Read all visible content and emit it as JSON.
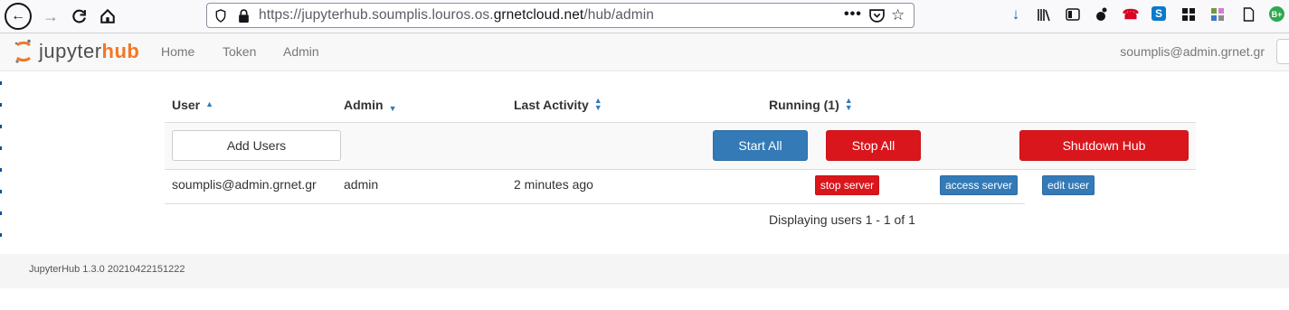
{
  "browser": {
    "url_prefix": "https://jupyterhub.soumplis.louros.os.",
    "url_host": "grnetcloud.net",
    "url_path": "/hub/admin",
    "extension_badge": "B+"
  },
  "header": {
    "logo_primary": "jupyter",
    "logo_secondary": "hub",
    "nav": [
      {
        "label": "Home"
      },
      {
        "label": "Token"
      },
      {
        "label": "Admin"
      }
    ],
    "user": "soumplis@admin.grnet.gr"
  },
  "table": {
    "columns": [
      {
        "label": "User",
        "sort": "asc"
      },
      {
        "label": "Admin",
        "sort": "desc"
      },
      {
        "label": "Last Activity",
        "sort": "both"
      },
      {
        "label": "Running (1)",
        "sort": "both"
      }
    ],
    "actions": {
      "add_users": "Add Users",
      "start_all": "Start All",
      "stop_all": "Stop All",
      "shutdown_hub": "Shutdown Hub"
    },
    "rows": [
      {
        "user": "soumplis@admin.grnet.gr",
        "admin": "admin",
        "last_activity": "2 minutes ago",
        "stop_label": "stop server",
        "access_label": "access server",
        "edit_label": "edit user"
      }
    ],
    "pagination": "Displaying users 1 - 1 of 1"
  },
  "footer": {
    "version": "JupyterHub 1.3.0 20210422151222"
  },
  "colors": {
    "primary": "#337ab7",
    "danger": "#d9161c",
    "jupyter_orange": "#f37726"
  }
}
